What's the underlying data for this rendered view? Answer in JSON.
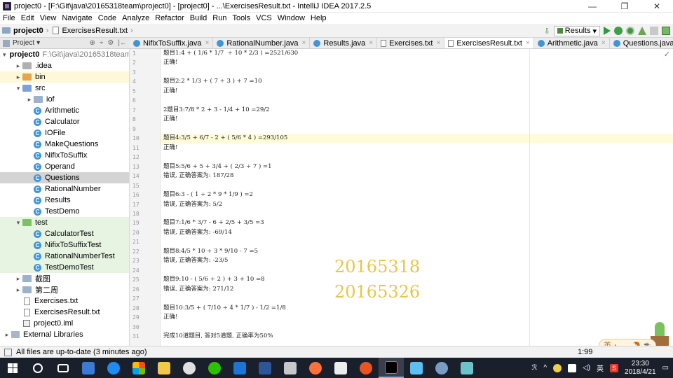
{
  "window": {
    "title": "project0 - [F:\\Git\\java\\20165318team\\project0] - [project0] - ...\\ExercisesResult.txt - IntelliJ IDEA 2017.2.5",
    "minimize": "—",
    "maximize": "❐",
    "close": "✕"
  },
  "menu": [
    "File",
    "Edit",
    "View",
    "Navigate",
    "Code",
    "Analyze",
    "Refactor",
    "Build",
    "Run",
    "Tools",
    "VCS",
    "Window",
    "Help"
  ],
  "breadcrumb": {
    "project": "project0",
    "file": "ExercisesResult.txt"
  },
  "toolbar": {
    "run_config": "Results"
  },
  "project_panel": {
    "header": "Project",
    "hdr_icons": [
      "⊕",
      "÷",
      "⚙",
      "|←"
    ]
  },
  "tree": [
    {
      "label": "project0",
      "hint": "F:\\Git\\java\\20165318team",
      "caret": "▾",
      "icon": "folder-plain",
      "indent": 0,
      "bold": true
    },
    {
      "label": ".idea",
      "caret": "▸",
      "icon": "folder-idea",
      "indent": 1
    },
    {
      "label": "bin",
      "caret": "▸",
      "icon": "folder-orange",
      "indent": 1,
      "style": "hl"
    },
    {
      "label": "src",
      "caret": "▾",
      "icon": "folder-blue",
      "indent": 1
    },
    {
      "label": "iof",
      "caret": "▸",
      "icon": "folder-plain",
      "indent": 2
    },
    {
      "label": "Arithmetic",
      "icon": "class",
      "indent": 2
    },
    {
      "label": "Calculator",
      "icon": "class",
      "indent": 2
    },
    {
      "label": "IOFile",
      "icon": "class",
      "indent": 2
    },
    {
      "label": "MakeQuestions",
      "icon": "class",
      "indent": 2
    },
    {
      "label": "NifixToSuffix",
      "icon": "class",
      "indent": 2
    },
    {
      "label": "Operand",
      "icon": "class",
      "indent": 2
    },
    {
      "label": "Questions",
      "icon": "class",
      "indent": 2,
      "style": "sel"
    },
    {
      "label": "RationalNumber",
      "icon": "class",
      "indent": 2
    },
    {
      "label": "Results",
      "icon": "class",
      "indent": 2
    },
    {
      "label": "TestDemo",
      "icon": "class",
      "indent": 2
    },
    {
      "label": "test",
      "caret": "▾",
      "icon": "folder-green",
      "indent": 1,
      "style": "test-bg"
    },
    {
      "label": "CalculatorTest",
      "icon": "class",
      "indent": 2,
      "style": "test-bg"
    },
    {
      "label": "NifixToSuffixTest",
      "icon": "class",
      "indent": 2,
      "style": "test-bg"
    },
    {
      "label": "RationalNumberTest",
      "icon": "class",
      "indent": 2,
      "style": "test-bg"
    },
    {
      "label": "TestDemoTest",
      "icon": "class",
      "indent": 2,
      "style": "test-bg"
    },
    {
      "label": "截图",
      "caret": "▸",
      "icon": "folder-plain",
      "indent": 1
    },
    {
      "label": "第二周",
      "caret": "▸",
      "icon": "folder-plain",
      "indent": 1
    },
    {
      "label": "Exercises.txt",
      "icon": "txt",
      "indent": 1
    },
    {
      "label": "ExercisesResult.txt",
      "icon": "txt",
      "indent": 1
    },
    {
      "label": "project0.iml",
      "icon": "iml",
      "indent": 1
    },
    {
      "label": "External Libraries",
      "caret": "▸",
      "icon": "lib",
      "indent": 0
    }
  ],
  "tabs": [
    {
      "label": "NifixToSuffix.java",
      "icon": "class"
    },
    {
      "label": "RationalNumber.java",
      "icon": "class"
    },
    {
      "label": "Results.java",
      "icon": "class"
    },
    {
      "label": "Exercises.txt",
      "icon": "txt"
    },
    {
      "label": "ExercisesResult.txt",
      "icon": "txt",
      "active": true
    },
    {
      "label": "Arithmetic.java",
      "icon": "class"
    },
    {
      "label": "Questions.java",
      "icon": "class"
    }
  ],
  "tab_close": "×",
  "editor": {
    "current_line": 10,
    "lines": [
      "题目1:4 + ( 1/6 * 1/7  ÷ 10 * 2/3 ) =2521/630",
      "正确!",
      "",
      "题目2:2 * 1/3 + ( 7 ÷ 3 ) + 7 =10",
      "正确!",
      "",
      "2题目3:7/8 * 2 + 3 - 1/4 + 10 =29/2",
      "正确!",
      "",
      "题目4:3/5 + 6/7 - 2 + ( 5/6 * 4 ) =293/105",
      "正确!",
      "",
      "题目5:5/6 + 5 + 3/4 + ( 2/3 ÷ 7 ) =1",
      "错误, 正确答案为: 187/28",
      "",
      "题目6:3 - ( 1 ÷ 2 * 9 * 1/9 ) =2",
      "错误, 正确答案为: 5/2",
      "",
      "题目7:1/6 * 3/7 - 6 + 2/5 + 3/5 =3",
      "错误, 正确答案为: -69/14",
      "",
      "题目8:4/5 * 10 ÷ 3 * 9/10 - 7 =5",
      "错误, 正确答案为: -23/5",
      "",
      "题目9:10 - ( 5/6 ÷ 2 ) + 3 + 10 =8",
      "错误, 正确答案为: 271/12",
      "",
      "题目10:3/5 + ( 7/10 ÷ 4 * 1/7 ) - 1/2 =1/8",
      "正确!",
      "",
      "完成10道题目, 答对5道题, 正确率为50%"
    ],
    "line_numbers": [
      "1",
      "2",
      "3",
      "4",
      "5",
      "6",
      "7",
      "8",
      "9",
      "10",
      "11",
      "12",
      "13",
      "14",
      "15",
      "16",
      "17",
      "18",
      "19",
      "20",
      "21",
      "22",
      "23",
      "24",
      "25",
      "26",
      "27",
      "28",
      "29",
      "30",
      "31"
    ],
    "watermark_1": "20165318",
    "watermark_2": "20165326",
    "inspection_ok": "✓"
  },
  "status": {
    "message": "All files are up-to-date (3 minutes ago)",
    "position": "1:99"
  },
  "ime": {
    "label": "英 ･ ,  ◡ ☂ ☕ ⚙"
  },
  "taskbar": {
    "time": "23:30",
    "date": "2018/4/21",
    "lang": "英",
    "ime_char": "S"
  },
  "colors": {
    "watermark": "#e8c547",
    "taskbar_bg": "#1a1f2c",
    "selected_row": "#d4d4d4",
    "test_row": "#e7f4e2"
  }
}
